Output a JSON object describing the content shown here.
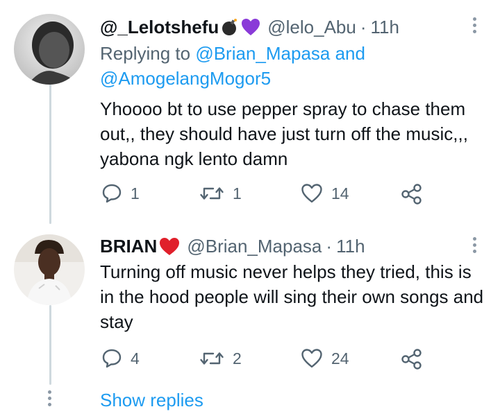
{
  "tweets": [
    {
      "name": "@_Lelotshefu",
      "badges": [
        "bomb-emoji",
        "purple-heart-emoji"
      ],
      "handle": "@lelo_Abu",
      "dot": "·",
      "time": "11h",
      "reply_prefix": "Replying to ",
      "reply_mention_1": "@Brian_Mapasa",
      "reply_and": " and",
      "reply_mention_2": "@AmogelangMogor5",
      "text": "Yhoooo bt to use pepper spray to chase them out,, they should have just turn off the music,,, yabona ngk lento damn",
      "replies": "1",
      "retweets": "1",
      "likes": "14"
    },
    {
      "name": "BRIAN",
      "badges": [
        "red-heart-emoji"
      ],
      "handle": "@Brian_Mapasa",
      "dot": "·",
      "time": "11h",
      "text": "Turning off music never helps they tried, this is in the hood people will sing their own songs and stay",
      "replies": "4",
      "retweets": "2",
      "likes": "24"
    }
  ],
  "show_replies": "Show replies",
  "colors": {
    "text": "#0f1419",
    "secondary": "#536471",
    "link": "#1d9bf0",
    "thread_line": "#cfd9de",
    "purple_heart": "#8a3bd8",
    "red_heart": "#e0202b"
  }
}
